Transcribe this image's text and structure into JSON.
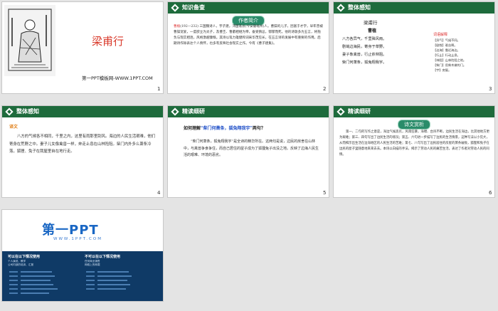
{
  "slides": [
    {
      "num": "1",
      "title": "梁甫行",
      "caption": "第一PPT模板网-WWW.1PPT.COM"
    },
    {
      "num": "2",
      "header": "知识备查",
      "badge": "作者简介",
      "name": "曹植",
      "years": "(192—232)",
      "body": "三国魏诗人，字子建，沛国谯县(今安徽亳州)人。曹操的儿子，因富于才学，早年曾被曹操宠爱，一度欲立为太子，及曹丕、曹叡相继为帝，备受猜忌，郁郁而死。他的诗歌多为五言，将抱负与现实相连，风格激越慷慨。其诗以笔力雄健和词采华茂见长，在五言诗的发展中有重要的作用。后期诗作除表达个人情怀，也多有反映社会现实之作。今有《曹子建集》。"
    },
    {
      "num": "3",
      "header": "整体感知",
      "poem_title": "梁甫行",
      "author": "曹植",
      "lines": [
        "八方各异气，千里殊风雨。",
        "剧哉边海民，寄身于草野。",
        "妻子象禽兽，行止依林阻。",
        "柴门何萧条，狐兔翔我宇。"
      ],
      "notes_title": "词语解释",
      "notes": [
        "【异气】气候不同。",
        "【剧哉】艰苦啊。",
        "【边海】靠近海边。",
        "【行止】行动止息。",
        "【林阻】山林险阻之地。",
        "【柴门】用柴木做的门。",
        "【宇】房屋。"
      ]
    },
    {
      "num": "4",
      "header": "整体感知",
      "label": "译文",
      "body": "八方的气候各不相同，千里之内，这里有雨那里刮风。海边的人民生活艰难，他们寄身在荒野之中。妻子儿女像禽兽一样，奔走止息在山林险阻。柴门内外多么萧条冷落，狐狸、兔子在我屋里自在地行走。"
    },
    {
      "num": "5",
      "header": "精读细研",
      "question_pre": "如何理解",
      "question_quote": "“柴门何萧条，狐兔翔我宇”",
      "question_post": "两句？",
      "answer": "“柴门何萧条，狐兔翔我宇”是全诗的精华所在。这两句是说，边民的房舍在山林中，与禽兽争食争住，而自己居住的屋子成为了狐狸兔子出没之地。反映了边海人民生活的艰难、环境的恶劣。"
    },
    {
      "num": "6",
      "header": "精读细研",
      "badge": "诗文赏析",
      "body": "第一、二句的写作之意是，海边气候恶劣，风雨狂暴，海啸、台风不断，边民生活在海边，比其他地方更为艰难；第三、四句写出了边民生活的境况；第五、六句进一步描写了边民的生活情景，这种写法以小见大，从而揭示出生活在边海地区的人民生活的苦难；第七、八句写出了边民居住的房屋的萧条破败，狐狸和兔子在边民的屋子里随意地来来去去。本诗以白描的手法，揭示了劳动人民的痛苦生活，表达了作者对劳动人民的同情。"
    },
    {
      "num": "7",
      "logo": "第一PPT",
      "url": "WWW.1PPT.COM",
      "can_title": "可以在以下情况使用",
      "cannot_title": "不可以在以下情况使用",
      "can_items": [
        "个人演说、教学",
        "公司内部的培训、汇报"
      ],
      "cannot_items": [
        "任何商业销售",
        "网络上的转载"
      ]
    }
  ]
}
